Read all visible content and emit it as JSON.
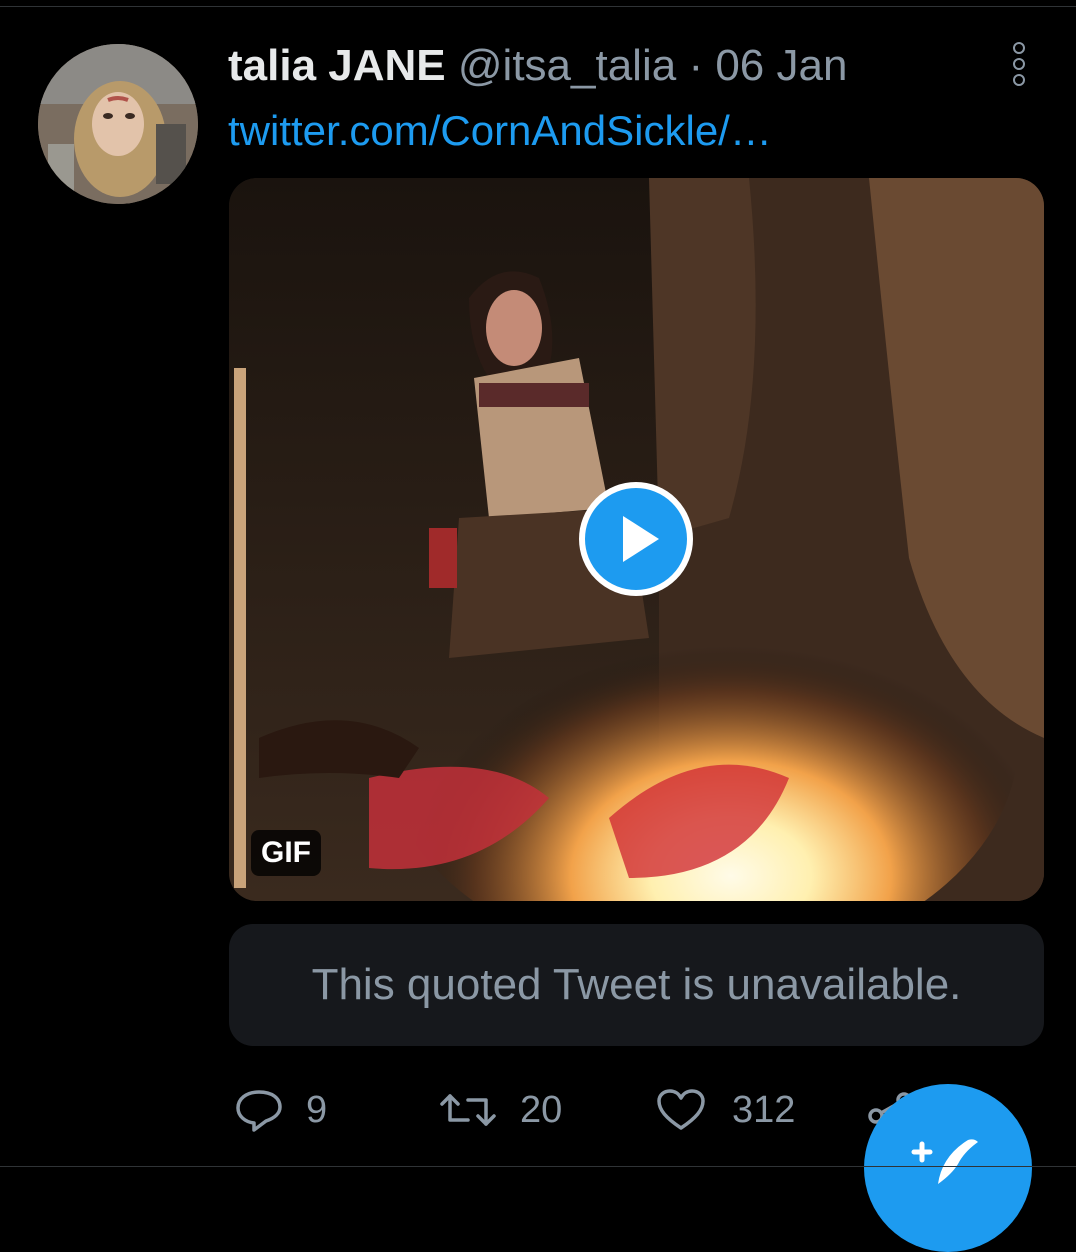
{
  "tweet": {
    "author": {
      "display_name": "talia JANE",
      "handle": "@itsa_talia"
    },
    "separator": "·",
    "date": "06 Jan",
    "link_text": "twitter.com/CornAndSickle/…",
    "media": {
      "type_badge": "GIF",
      "play_icon": "play-icon"
    },
    "quoted_tweet": {
      "message": "This quoted Tweet is unavailable."
    },
    "actions": {
      "reply_count": "9",
      "retweet_count": "20",
      "like_count": "312"
    }
  },
  "icons": {
    "more": "more-vertical-icon",
    "reply": "reply-icon",
    "retweet": "retweet-icon",
    "like": "heart-icon",
    "share": "share-icon",
    "compose": "compose-tweet-icon"
  },
  "colors": {
    "background": "#000000",
    "accent": "#1d9bf0",
    "text_primary": "#e7e9ea",
    "text_secondary": "#8b98a5",
    "card_background": "#16181c"
  }
}
